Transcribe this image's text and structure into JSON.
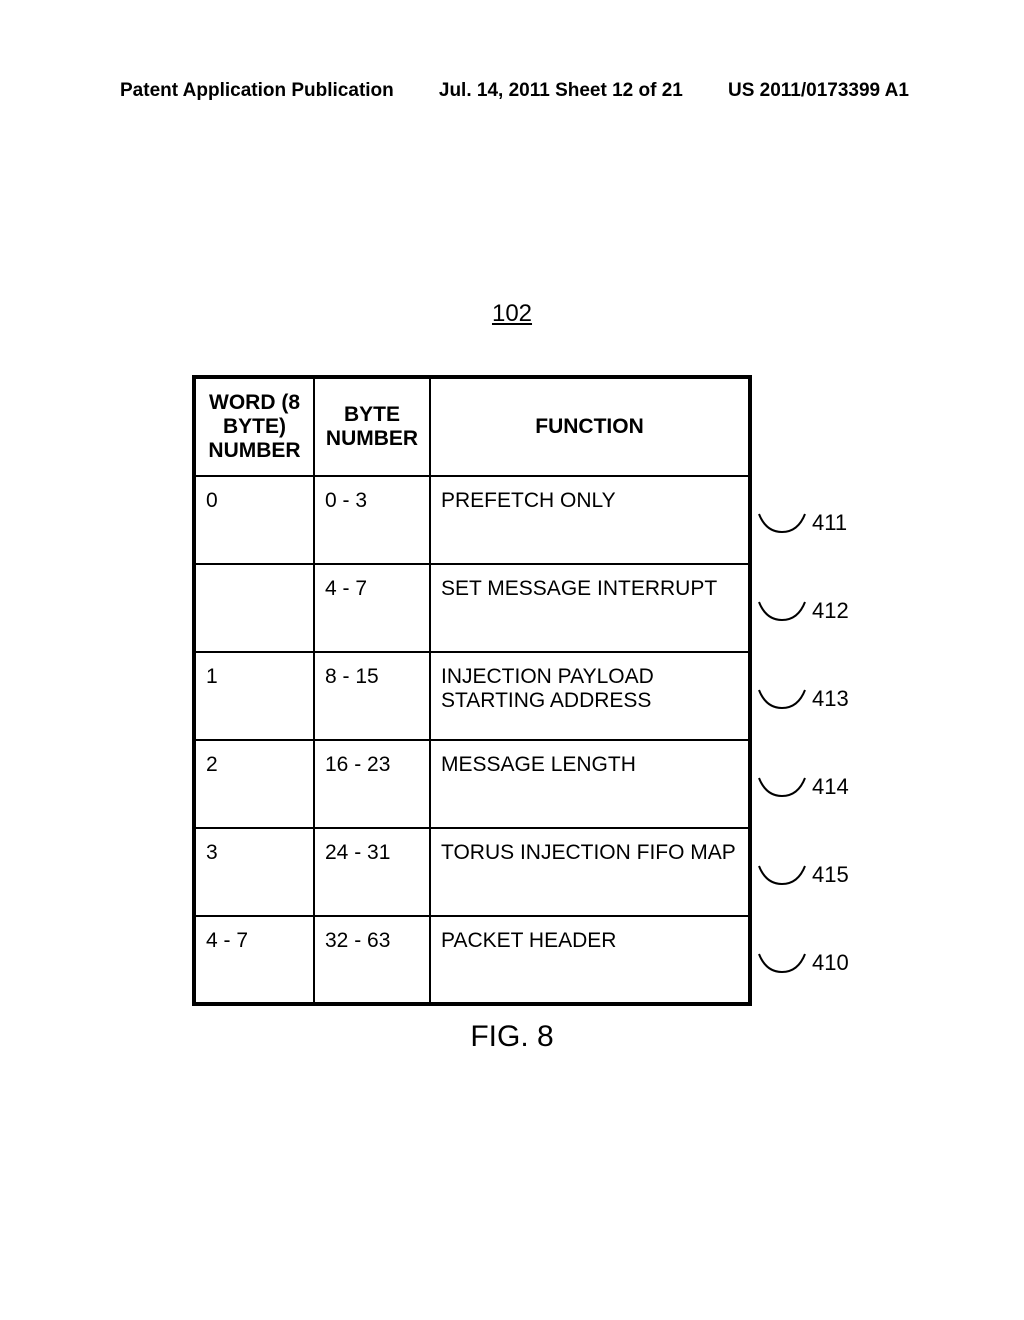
{
  "header": {
    "left": "Patent Application Publication",
    "mid": "Jul. 14, 2011  Sheet 12 of 21",
    "right": "US 2011/0173399 A1"
  },
  "figure_ref": "102",
  "table": {
    "headers": {
      "word": "WORD (8 BYTE) NUMBER",
      "byte": "BYTE NUMBER",
      "func": "FUNCTION"
    },
    "rows": [
      {
        "word": "0",
        "byte": "0 - 3",
        "func": "PREFETCH ONLY",
        "callout": "411"
      },
      {
        "word": "",
        "byte": "4 - 7",
        "func": "SET MESSAGE INTERRUPT",
        "callout": "412"
      },
      {
        "word": "1",
        "byte": "8 - 15",
        "func": "INJECTION PAYLOAD STARTING ADDRESS",
        "callout": "413"
      },
      {
        "word": "2",
        "byte": "16 - 23",
        "func": "MESSAGE LENGTH",
        "callout": "414"
      },
      {
        "word": "3",
        "byte": "24 - 31",
        "func": "TORUS INJECTION FIFO MAP",
        "callout": "415"
      },
      {
        "word": "4 - 7",
        "byte": "32 - 63",
        "func": "PACKET HEADER",
        "callout": "410"
      }
    ]
  },
  "caption": "FIG. 8"
}
